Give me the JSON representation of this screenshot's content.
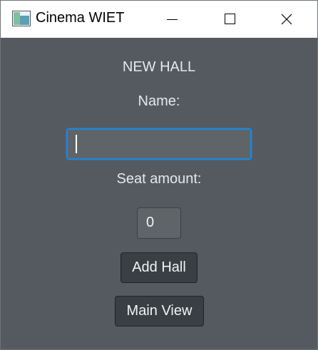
{
  "window": {
    "title": "Cinema WIET",
    "controls": {
      "minimize_icon": "minimize-icon",
      "maximize_icon": "maximize-icon",
      "close_icon": "close-icon"
    }
  },
  "form": {
    "heading": "NEW HALL",
    "name_label": "Name:",
    "name_value": "",
    "seat_label": "Seat amount:",
    "seat_value": "0"
  },
  "buttons": {
    "add_hall": "Add Hall",
    "main_view": "Main View"
  },
  "colors": {
    "background": "#555a60",
    "focus_accent": "#1f87d8",
    "button_bg": "#3a3f44",
    "text": "#e6e8ea"
  }
}
